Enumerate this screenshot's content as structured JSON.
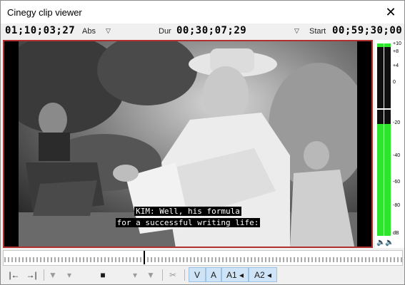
{
  "window": {
    "title": "Cinegy clip viewer",
    "close_glyph": "✕"
  },
  "timecodes": {
    "abs": {
      "value": "01;10;03;27",
      "label": "Abs"
    },
    "dur": {
      "value": "00;30;07;29",
      "label": "Dur"
    },
    "start": {
      "value": "00;59;30;00",
      "label": "Start"
    },
    "dropdown_glyph": "▽"
  },
  "video": {
    "subtitle_line1": "KIM: Well, his formula",
    "subtitle_line2": "for a successful writing life:"
  },
  "audio_meter": {
    "scale": [
      "+10",
      "+8",
      "+4",
      "0",
      "-20",
      "-40",
      "-60",
      "-80",
      "dB"
    ],
    "level_fraction_left": 0.58,
    "level_fraction_right": 0.58,
    "speaker_glyph": "🔈"
  },
  "toolbar": {
    "goto_start": "|←",
    "goto_end": "→|",
    "mark_in": "▼",
    "mark_in_small": "▾",
    "stop": "■",
    "mark_out_small": "▾",
    "mark_out": "▼",
    "cut": "✂",
    "video_label": "V",
    "audio_label": "A",
    "a1_label": "A1 ◂",
    "a2_label": "A2 ◂"
  },
  "colors": {
    "meter_green": "#2ee52e",
    "border_red": "#b03030",
    "selected_blue": "#cfe5f7"
  }
}
